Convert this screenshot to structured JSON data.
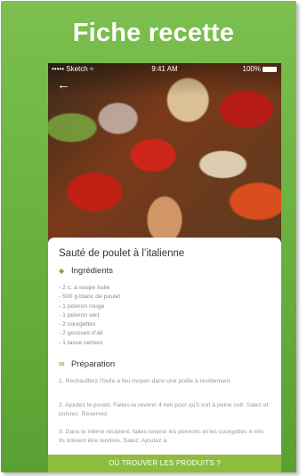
{
  "card": {
    "title": "Fiche recette"
  },
  "status_bar": {
    "carrier": "••••• Sketch",
    "wifi_icon": "wifi-icon",
    "time": "9:41 AM",
    "battery": "100%"
  },
  "recipe": {
    "title": "Sauté de poulet à l’italienne",
    "ingredients_heading": "Ingrédients",
    "ingredients": [
      "- 2 c. à soupe huile",
      "- 500 g blanc de poulet",
      "- 1 poivron rouge",
      "- 1 poivron vert",
      "- 2 courgettes",
      "- 2 gousses d’ail",
      "- 1 tasse cerises"
    ],
    "preparation_heading": "Préparation",
    "steps": [
      "1. Réchaufferz l’huile à feu moyen dans une poêle à revêtement",
      "2. Ajoutez le poulet. Faites-le revenir 4 min pour qu’il soit à peine cuit. Salez et poivrez. Réservez.",
      "3. Dans le même récipient, faites revenir les poivrons et les courgettes 4 min. Ils doivent être tendres. Salez. Ajoutez à"
    ]
  },
  "cta": {
    "label": "OÙ TROUVER LES PRODUITS ?"
  },
  "colors": {
    "green": "#6ab340",
    "cta": "#8ebd3e"
  }
}
